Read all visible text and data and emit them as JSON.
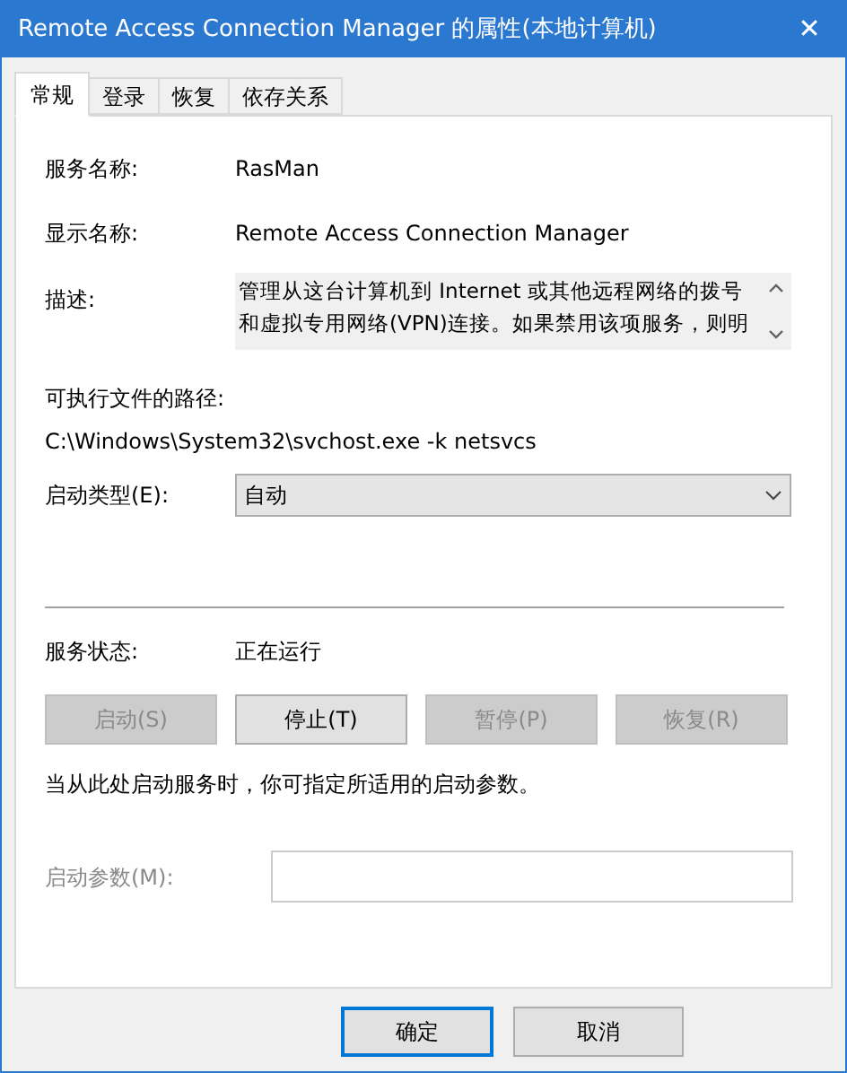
{
  "window": {
    "title": "Remote Access Connection Manager 的属性(本地计算机)",
    "close": "✕"
  },
  "tabs": [
    {
      "label": "常规",
      "selected": true
    },
    {
      "label": "登录",
      "selected": false
    },
    {
      "label": "恢复",
      "selected": false
    },
    {
      "label": "依存关系",
      "selected": false
    }
  ],
  "service_name": {
    "label": "服务名称:",
    "value": "RasMan"
  },
  "display_name": {
    "label": "显示名称:",
    "value": "Remote Access Connection Manager"
  },
  "description": {
    "label": "描述:",
    "value": "管理从这台计算机到 Internet 或其他远程网络的拨号和虚拟专用网络(VPN)连接。如果禁用该项服务，则明"
  },
  "executable_path": {
    "label": "可执行文件的路径:",
    "value": "C:\\Windows\\System32\\svchost.exe -k netsvcs"
  },
  "startup_type": {
    "label": "启动类型(E):",
    "value": "自动"
  },
  "service_status": {
    "label": "服务状态:",
    "value": "正在运行"
  },
  "service_buttons": [
    {
      "label": "启动(S)",
      "disabled": true
    },
    {
      "label": "停止(T)",
      "disabled": false
    },
    {
      "label": "暂停(P)",
      "disabled": true
    },
    {
      "label": "恢复(R)",
      "disabled": true
    }
  ],
  "hint": "当从此处启动服务时，你可指定所适用的启动参数。",
  "start_parameters": {
    "label": "启动参数(M):",
    "disabled": true
  },
  "dialog_buttons": [
    {
      "label": "确定",
      "default": true
    },
    {
      "label": "取消",
      "default": false
    }
  ]
}
